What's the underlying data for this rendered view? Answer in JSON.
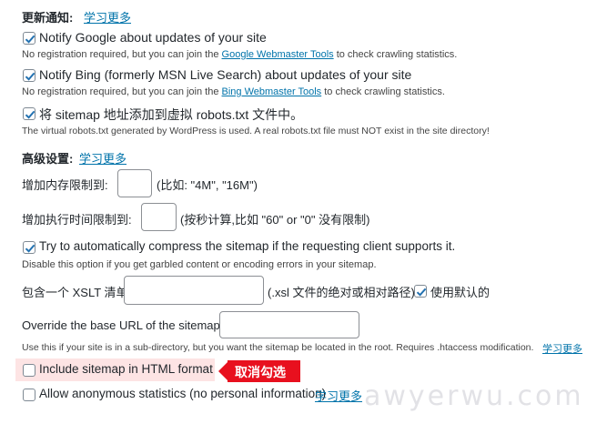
{
  "update_notify": {
    "heading": "更新通知:",
    "learn_more": "学习更多",
    "google": {
      "label": "Notify Google about updates of your site",
      "desc_before": "No registration required, but you can join the ",
      "desc_link": "Google Webmaster Tools",
      "desc_after": " to check crawling statistics.",
      "checked": true
    },
    "bing": {
      "label": "Notify Bing (formerly MSN Live Search) about updates of your site",
      "desc_before": "No registration required, but you can join the ",
      "desc_link": "Bing Webmaster Tools",
      "desc_after": " to check crawling statistics.",
      "checked": true
    },
    "robots": {
      "label": "将 sitemap 地址添加到虚拟 robots.txt 文件中。",
      "desc": "The virtual robots.txt generated by WordPress is used. A real robots.txt file must NOT exist in the site directory!",
      "checked": true
    }
  },
  "advanced": {
    "heading": "高级设置:",
    "learn_more": "学习更多",
    "memory": {
      "label": "增加内存限制到:",
      "hint": "(比如: \"4M\", \"16M\")",
      "value": ""
    },
    "exec_time": {
      "label": "增加执行时间限制到:",
      "hint": "(按秒计算,比如 \"60\" or \"0\" 没有限制)",
      "value": ""
    },
    "compress": {
      "label": "Try to automatically compress the sitemap if the requesting client supports it.",
      "desc": "Disable this option if you get garbled content or encoding errors in your sitemap.",
      "checked": true
    },
    "xslt": {
      "label": "包含一个 XSLT 清单",
      "hint": "(.xsl 文件的绝对或相对路径)",
      "default_label": "使用默认的",
      "default_checked": true,
      "value": ""
    },
    "base_url": {
      "label": "Override the base URL of the sitemap:",
      "value": "",
      "desc": "Use this if your site is in a sub-directory, but you want the sitemap be located in the root. Requires .htaccess modification.",
      "learn_more": "学习更多"
    },
    "html_format": {
      "label": "Include sitemap in HTML format",
      "checked": false
    },
    "anonymous": {
      "label": "Allow anonymous statistics (no personal information)",
      "learn_more": "学习更多",
      "checked": false
    }
  },
  "annotation": {
    "callout": "取消勾选",
    "color": "#e8101e",
    "highlight_color": "#fde4e4"
  },
  "watermark": "awyerwu.com"
}
